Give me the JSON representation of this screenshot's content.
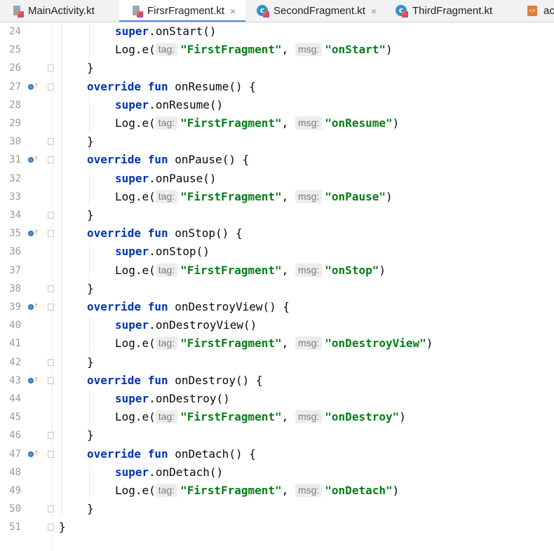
{
  "tabs": [
    {
      "label": "MainActivity.kt",
      "icon": "kotlin-file-icon",
      "active": false,
      "closable": false
    },
    {
      "label": "FirsrFragment.kt",
      "icon": "kotlin-file-icon",
      "active": true,
      "closable": true
    },
    {
      "label": "SecondFragment.kt",
      "icon": "kotlin-class-icon",
      "active": false,
      "closable": true
    },
    {
      "label": "ThirdFragment.kt",
      "icon": "kotlin-class-icon",
      "active": false,
      "closable": false
    },
    {
      "label": "acti",
      "icon": "xml-layout-icon",
      "active": false,
      "closable": false
    }
  ],
  "close_glyph": "×",
  "hint_tag": "tag:",
  "hint_msg": "msg:",
  "lines": [
    {
      "n": "24",
      "kind": "super",
      "method": "onStart"
    },
    {
      "n": "25",
      "kind": "log",
      "msg": "\"onStart\""
    },
    {
      "n": "26",
      "kind": "close",
      "fold": true
    },
    {
      "n": "27",
      "kind": "decl",
      "method": "onResume",
      "override_marker": true,
      "fold": true
    },
    {
      "n": "28",
      "kind": "super",
      "method": "onResume"
    },
    {
      "n": "29",
      "kind": "log",
      "msg": "\"onResume\""
    },
    {
      "n": "30",
      "kind": "close",
      "fold": true
    },
    {
      "n": "31",
      "kind": "decl",
      "method": "onPause",
      "override_marker": true,
      "fold": true
    },
    {
      "n": "32",
      "kind": "super",
      "method": "onPause"
    },
    {
      "n": "33",
      "kind": "log",
      "msg": "\"onPause\""
    },
    {
      "n": "34",
      "kind": "close",
      "fold": true
    },
    {
      "n": "35",
      "kind": "decl",
      "method": "onStop",
      "override_marker": true,
      "fold": true
    },
    {
      "n": "36",
      "kind": "super",
      "method": "onStop"
    },
    {
      "n": "37",
      "kind": "log",
      "msg": "\"onStop\""
    },
    {
      "n": "38",
      "kind": "close",
      "fold": true
    },
    {
      "n": "39",
      "kind": "decl",
      "method": "onDestroyView",
      "override_marker": true,
      "fold": true
    },
    {
      "n": "40",
      "kind": "super",
      "method": "onDestroyView"
    },
    {
      "n": "41",
      "kind": "log",
      "msg": "\"onDestroyView\""
    },
    {
      "n": "42",
      "kind": "close",
      "fold": true
    },
    {
      "n": "43",
      "kind": "decl",
      "method": "onDestroy",
      "override_marker": true,
      "fold": true
    },
    {
      "n": "44",
      "kind": "super",
      "method": "onDestroy"
    },
    {
      "n": "45",
      "kind": "log",
      "msg": "\"onDestroy\""
    },
    {
      "n": "46",
      "kind": "close",
      "fold": true
    },
    {
      "n": "47",
      "kind": "decl",
      "method": "onDetach",
      "override_marker": true,
      "fold": true
    },
    {
      "n": "48",
      "kind": "super",
      "method": "onDetach"
    },
    {
      "n": "49",
      "kind": "log",
      "msg": "\"onDetach\""
    },
    {
      "n": "50",
      "kind": "close",
      "fold": true
    },
    {
      "n": "51",
      "kind": "classclose",
      "fold": true
    }
  ],
  "tokens": {
    "override": "override",
    "fun": "fun",
    "super": "super",
    "log_call": "Log.e(",
    "tag_value": "\"FirstFragment\"",
    "comma": ",",
    "close_paren": ")",
    "call_parens": "()",
    "decl_tail": "() {",
    "close_brace": "}"
  },
  "colors": {
    "keyword": "#0033b3",
    "string": "#067d17",
    "text": "#080808",
    "line_number": "#999999",
    "active_tab_underline": "#4a86e8"
  }
}
